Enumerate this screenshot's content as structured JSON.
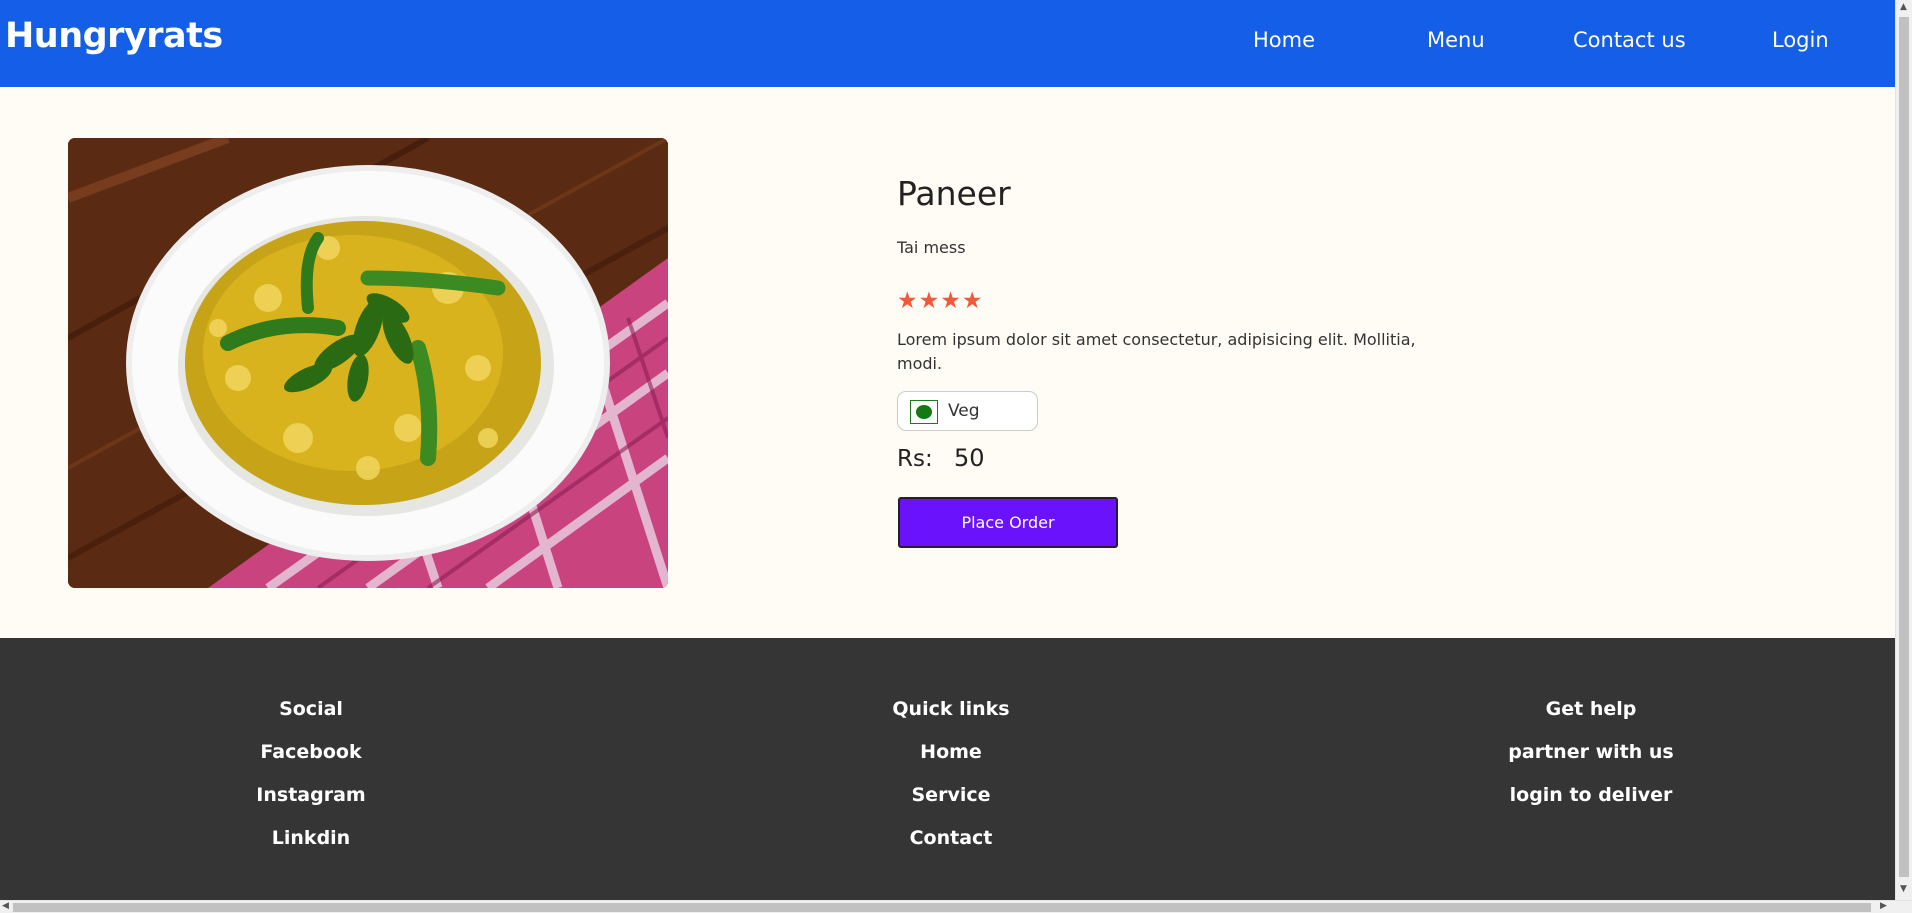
{
  "header": {
    "brand": "Hungryrats",
    "nav": {
      "home": "Home",
      "menu": "Menu",
      "contact": "Contact us",
      "login": "Login"
    }
  },
  "product": {
    "image_icon": "food-photo",
    "name": "Paneer",
    "mess": "Tai mess",
    "rating": 4,
    "stars": [
      "★",
      "★",
      "★",
      "★"
    ],
    "description": "Lorem ipsum dolor sit amet consectetur, adipisicing elit. Mollitia, modi.",
    "diet_label": "Veg",
    "price_label": "Rs:",
    "price": "50",
    "order_button": "Place Order"
  },
  "footer": {
    "social": {
      "heading": "Social",
      "links": [
        "Facebook",
        "Instagram",
        "Linkdin"
      ]
    },
    "quick_links": {
      "heading": "Quick links",
      "links": [
        "Home",
        "Service",
        "Contact"
      ]
    },
    "help": {
      "heading": "Get help",
      "links": [
        "partner with us",
        "login to deliver"
      ]
    }
  },
  "colors": {
    "header_bg": "#145ee8",
    "page_bg": "#fffcf6",
    "star": "#ef5a3a",
    "veg_green": "#127a12",
    "order_button": "#6a12fb",
    "footer_bg": "#353535"
  }
}
